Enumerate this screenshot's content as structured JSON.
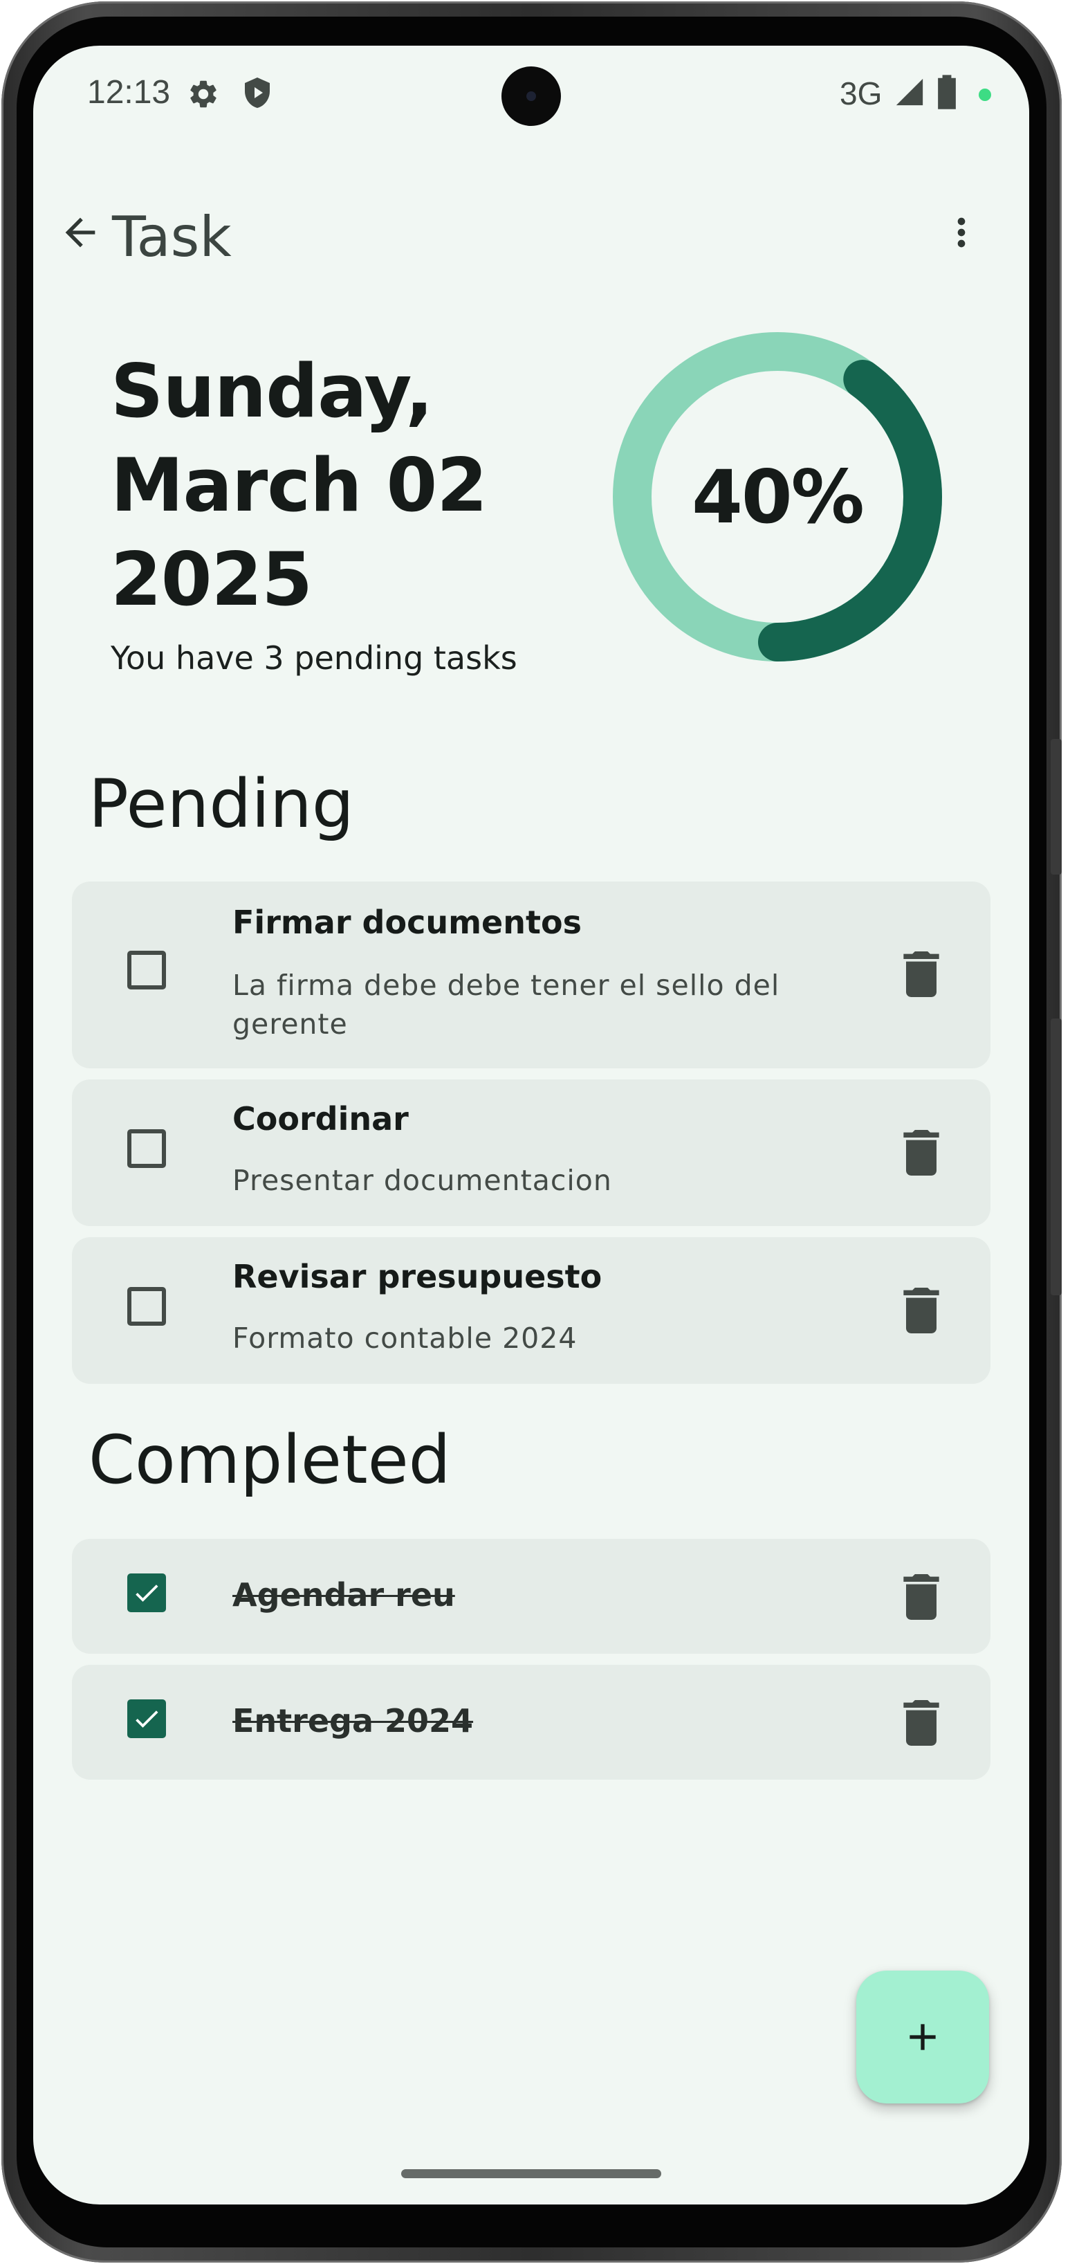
{
  "status_bar": {
    "time": "12:13",
    "network": "3G",
    "icons": [
      "settings-icon",
      "shield-play-icon",
      "signal-icon",
      "battery-icon",
      "privacy-dot-icon"
    ]
  },
  "app_bar": {
    "title": "Task",
    "back_icon": "arrow-back-icon",
    "menu_icon": "more-vert-icon"
  },
  "header": {
    "date_line_1": "Sunday,",
    "date_line_2": "March 02",
    "date_line_3": "2025",
    "pending_text": "You have 3 pending tasks",
    "progress_percent": 40,
    "progress_label": "40%"
  },
  "sections": {
    "pending_title": "Pending",
    "completed_title": "Completed"
  },
  "pending_tasks": [
    {
      "title": "Firmar documentos",
      "description": "La firma debe debe tener el sello del gerente",
      "checked": false
    },
    {
      "title": "Coordinar",
      "description": "Presentar documentacion",
      "checked": false
    },
    {
      "title": "Revisar presupuesto",
      "description": "Formato contable 2024",
      "checked": false
    }
  ],
  "completed_tasks": [
    {
      "title": "Agendar reu",
      "checked": true
    },
    {
      "title": "Entrega 2024",
      "checked": true
    }
  ],
  "fab": {
    "icon": "plus-icon"
  },
  "colors": {
    "background": "#f1f7f3",
    "card": "#e5ece8",
    "accent": "#15654f",
    "progress_track": "#8ad5b8",
    "fab": "#a3f0d1",
    "icon": "#444b47"
  }
}
